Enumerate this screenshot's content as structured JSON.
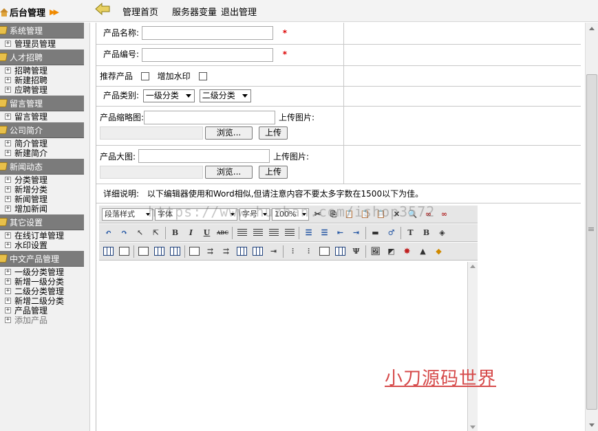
{
  "header": {
    "brand": "后台管理",
    "nav": [
      "管理首页",
      "服务器变量",
      "退出管理"
    ]
  },
  "sidebar": {
    "sections": [
      {
        "title": "系统管理",
        "items": [
          "管理员管理"
        ]
      },
      {
        "title": "人才招聘",
        "items": [
          "招聘管理",
          "新建招聘",
          "应聘管理"
        ]
      },
      {
        "title": "留言管理",
        "items": [
          "留言管理"
        ]
      },
      {
        "title": "公司简介",
        "items": [
          "简介管理",
          "新建简介"
        ]
      },
      {
        "title": "新闻动态",
        "items": [
          "分类管理",
          "新增分类",
          "新闻管理",
          "增加新闻"
        ]
      },
      {
        "title": "其它设置",
        "items": [
          "在线订单管理",
          "水印设置"
        ]
      },
      {
        "title": "中文产品管理",
        "items": [
          "一级分类管理",
          "新增一级分类",
          "二级分类管理",
          "新增二级分类",
          "产品管理",
          "添加产品"
        ]
      }
    ]
  },
  "form": {
    "product_name_label": "产品名称:",
    "product_code_label": "产品编号:",
    "required_mark": "*",
    "recommend_label": "推荐产品",
    "watermark_label": "增加水印",
    "category_label": "产品类别:",
    "category1": "一级分类",
    "category2": "二级分类",
    "thumb_label": "产品缩略图:",
    "big_label": "产品大图:",
    "upload_label": "上传图片:",
    "browse_btn": "浏览...",
    "upload_btn": "上传",
    "detail_label": "详细说明:",
    "detail_note": "以下编辑器使用和Word相似,但请注意内容不要太多字数在1500以下为佳。"
  },
  "editor": {
    "paragraph_style": "段落样式",
    "font": "字体",
    "font_size": "字号",
    "zoom": "100%",
    "bold": "B",
    "italic": "I",
    "underline": "U",
    "strike": "ABC"
  },
  "watermarks": {
    "url": "https://www.huzhan.com/ishop3572",
    "text": "小刀源码世界"
  }
}
